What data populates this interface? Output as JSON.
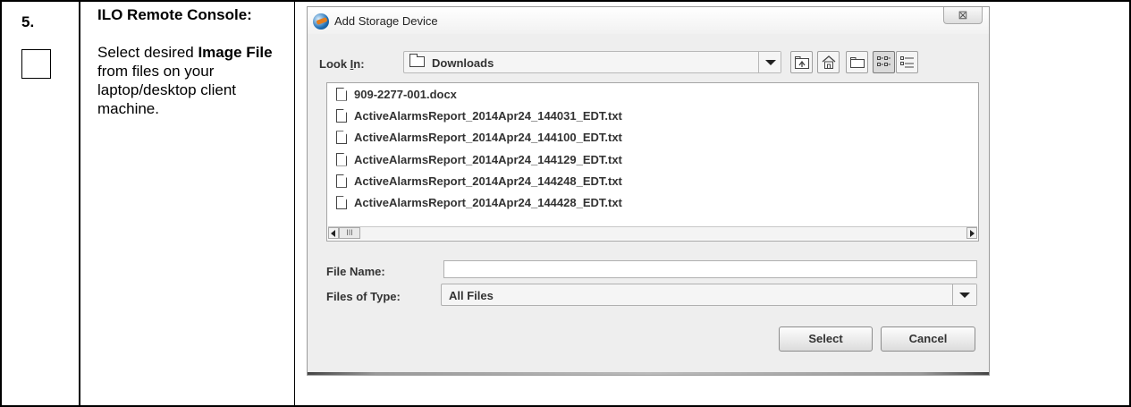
{
  "step": {
    "number": "5.",
    "title": "ILO Remote Console:",
    "instruction_pre": "Select desired ",
    "instruction_bold": "Image File",
    "instruction_post": " from files on your laptop/desktop client machine."
  },
  "dialog": {
    "title": "Add Storage Device",
    "close_glyph": "⊠",
    "look_in_label": "Look In:",
    "look_in_mnemonic": "I",
    "look_in_value": "Downloads",
    "toolbar_icons": [
      "up-folder-icon",
      "home-icon",
      "new-folder-icon",
      "list-view-icon",
      "details-view-icon"
    ],
    "files": [
      "909-2277-001.docx",
      "ActiveAlarmsReport_2014Apr24_144031_EDT.txt",
      "ActiveAlarmsReport_2014Apr24_144100_EDT.txt",
      "ActiveAlarmsReport_2014Apr24_144129_EDT.txt",
      "ActiveAlarmsReport_2014Apr24_144248_EDT.txt",
      "ActiveAlarmsReport_2014Apr24_144428_EDT.txt"
    ],
    "scroll_thumb": "III",
    "file_name_label": "File Name:",
    "file_name_value": "",
    "files_of_type_label": "Files of Type:",
    "files_of_type_value": "All Files",
    "select_label": "Select",
    "cancel_label": "Cancel"
  }
}
